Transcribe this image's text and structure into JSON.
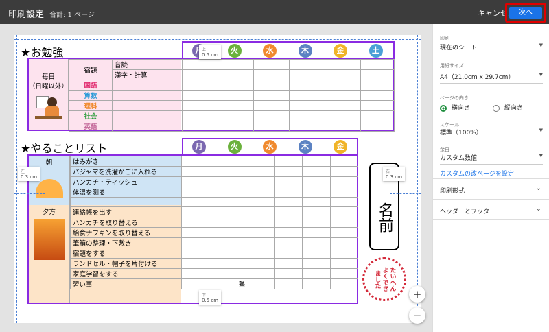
{
  "window": {
    "title": "印刷設定",
    "page_count": "合計: 1 ページ",
    "cancel_label": "キャンセル",
    "next_label": "次へ"
  },
  "sheet": {
    "study": {
      "title": "★お勉強",
      "days": [
        "月",
        "火",
        "水",
        "木",
        "金",
        "土"
      ],
      "left_label": "毎日\n（日曜以外）",
      "homework_label": "宿題",
      "rows": [
        "音読",
        "漢字・計算"
      ],
      "subjects": [
        "国語",
        "算数",
        "理科",
        "社会",
        "英語"
      ]
    },
    "todo": {
      "title": "★やることリスト",
      "days": [
        "月",
        "火",
        "水",
        "木",
        "金"
      ],
      "morning_label": "朝",
      "evening_label": "夕方",
      "morning_items": [
        "はみがき",
        "パジャマを洗濯かごに入れる",
        "ハンカチ・ティッシュ",
        "体温を測る"
      ],
      "evening_items": [
        "連絡帳を出す",
        "ハンカチを取り替える",
        "給食ナフキンを取り替える",
        "筆箱の整理・下敷き",
        "宿題をする",
        "ランドセル・帽子を片付ける",
        "家庭学習をする",
        "習い事"
      ],
      "cram_label": "塾"
    },
    "name_box": "名前",
    "stamp_text": "たいへんよくできました"
  },
  "margins": {
    "top": {
      "label": "上",
      "value": "0.5 cm"
    },
    "left": {
      "label": "左",
      "value": "0.3 cm"
    },
    "right": {
      "label": "右",
      "value": "0.3 cm"
    },
    "bottom": {
      "label": "下",
      "value": "0.5 cm"
    }
  },
  "zoom": {
    "in": "+",
    "out": "−"
  },
  "settings": {
    "print_label": "印刷",
    "print_value": "現在のシート",
    "paper_label": "用紙サイズ",
    "paper_value": "A4（21.0cm x 29.7cm）",
    "orientation_label": "ページの向き",
    "landscape": "横向き",
    "portrait": "縦向き",
    "scale_label": "スケール",
    "scale_value": "標準（100%）",
    "margin_label": "余白",
    "margin_value": "カスタム数値",
    "page_break_link": "カスタムの改ページを設定",
    "format_label": "印刷形式",
    "header_footer_label": "ヘッダーとフッター"
  },
  "colors": {
    "days": [
      "#7b68b0",
      "#6bb13c",
      "#f08a2e",
      "#5b82c2",
      "#f0b428",
      "#4aa0d6"
    ],
    "frame": "#8a2be2",
    "study_bg": "#fde3ee",
    "morning_bg": "#cfe4f5",
    "evening_bg": "#fde4c8",
    "accent": "#1a73e8",
    "highlight": "#e00000"
  }
}
